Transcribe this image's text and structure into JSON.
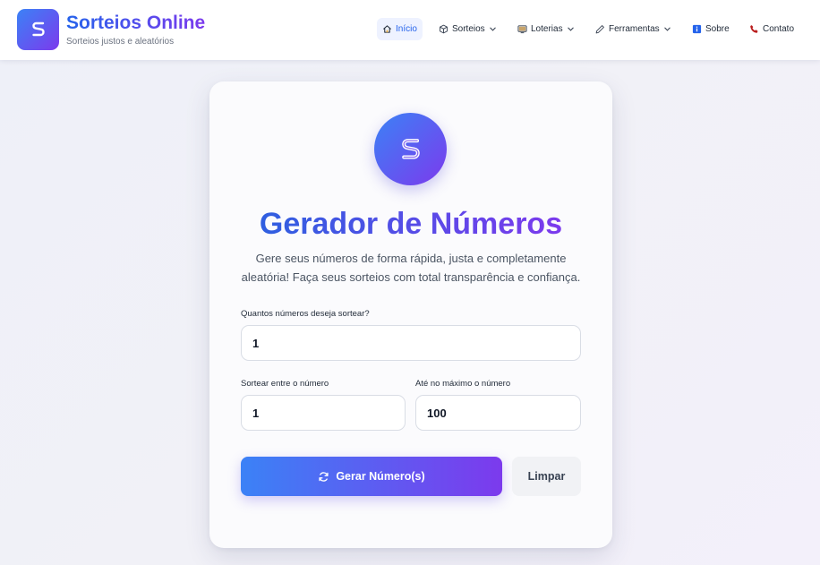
{
  "brand": {
    "title": "Sorteios Online",
    "subtitle": "Sorteios justos e aleatórios",
    "logo_icon": "s-logo-icon"
  },
  "nav": {
    "items": [
      {
        "label": "Início",
        "icon": "home-icon",
        "active": true,
        "dropdown": false
      },
      {
        "label": "Sorteios",
        "icon": "cube-icon",
        "active": false,
        "dropdown": true
      },
      {
        "label": "Loterias",
        "icon": "monitor-icon",
        "active": false,
        "dropdown": true
      },
      {
        "label": "Ferramentas",
        "icon": "pencil-icon",
        "active": false,
        "dropdown": true
      },
      {
        "label": "Sobre",
        "icon": "info-icon",
        "active": false,
        "dropdown": false
      },
      {
        "label": "Contato",
        "icon": "phone-icon",
        "active": false,
        "dropdown": false
      }
    ]
  },
  "card": {
    "title": "Gerador de Números",
    "description": "Gere seus números de forma rápida, justa e completamente aleatória! Faça seus sorteios com total transparência e confiança.",
    "quantity": {
      "label": "Quantos números deseja sortear?",
      "value": "1"
    },
    "min": {
      "label": "Sortear entre o número",
      "value": "1"
    },
    "max": {
      "label": "Até no máximo o número",
      "value": "100"
    },
    "generate_label": "Gerar Número(s)",
    "clear_label": "Limpar"
  },
  "colors": {
    "accent_start": "#3b82f6",
    "accent_end": "#7c3aed",
    "active_nav_bg": "#eef2ff",
    "active_nav_text": "#2563eb"
  }
}
